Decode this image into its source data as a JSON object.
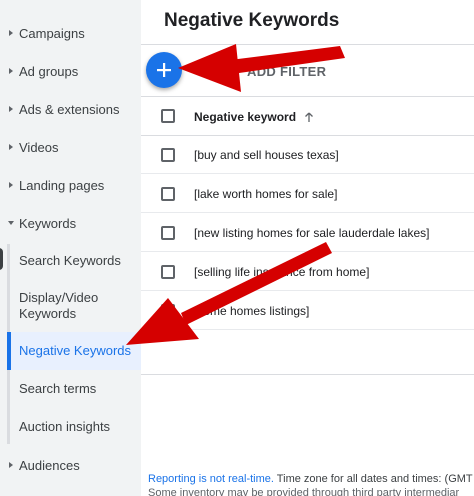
{
  "sidebar": {
    "items": [
      {
        "label": "Campaigns"
      },
      {
        "label": "Ad groups"
      },
      {
        "label": "Ads & extensions"
      },
      {
        "label": "Videos"
      },
      {
        "label": "Landing pages"
      },
      {
        "label": "Keywords"
      }
    ],
    "keyword_subitems": [
      {
        "label": "Search Keywords"
      },
      {
        "label": "Display/Video Keywords"
      },
      {
        "label": "Negative Keywords"
      },
      {
        "label": "Search terms"
      },
      {
        "label": "Auction insights"
      }
    ],
    "audiences": {
      "label": "Audiences"
    }
  },
  "main": {
    "title": "Negative Keywords",
    "add_filter_label": "ADD FILTER",
    "column_header": "Negative keyword",
    "rows": [
      {
        "keyword": "[buy and sell houses texas]"
      },
      {
        "keyword": "[lake worth homes for sale]"
      },
      {
        "keyword": "[new listing homes for sale lauderdale lakes]"
      },
      {
        "keyword": "[selling life insurance from home]"
      },
      {
        "keyword": "[xome homes listings]"
      }
    ]
  },
  "footer": {
    "link_text": "Reporting is not real-time.",
    "text": " Time zone for all dates and times: (GMT",
    "line2": "Some inventory may be provided through third party intermediar"
  },
  "colors": {
    "accent": "#1a73e8",
    "annotation_arrow": "#d50000",
    "sidebar_bg": "#f1f3f4"
  },
  "icons": {
    "add": "plus-icon",
    "filter": "filter-icon",
    "sort": "arrow-up-icon"
  }
}
